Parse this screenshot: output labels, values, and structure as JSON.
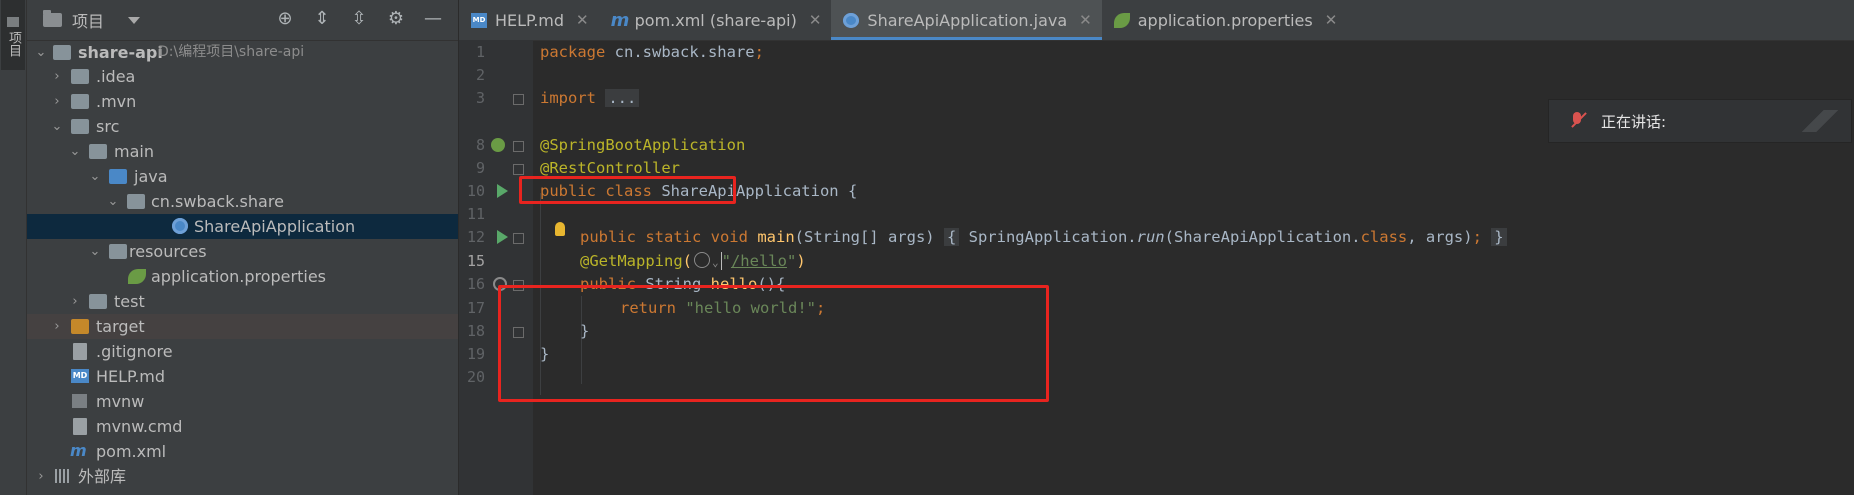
{
  "toolstrip": {
    "project_tab": "项目"
  },
  "project_panel": {
    "title": "项目",
    "tree": [
      {
        "label": "share-api",
        "path": "D:\\编程项目\\share-api",
        "icon": "folder-icon",
        "bold": true
      },
      {
        "label": ".idea",
        "icon": "folder-icon"
      },
      {
        "label": ".mvn",
        "icon": "folder-icon"
      },
      {
        "label": "src",
        "icon": "folder-icon"
      },
      {
        "label": "main",
        "icon": "folder-icon"
      },
      {
        "label": "java",
        "icon": "source-folder-icon"
      },
      {
        "label": "cn.swback.share",
        "icon": "package-icon"
      },
      {
        "label": "ShareApiApplication",
        "icon": "spring-boot-class-icon"
      },
      {
        "label": "resources",
        "icon": "resources-folder-icon"
      },
      {
        "label": "application.properties",
        "icon": "spring-properties-icon"
      },
      {
        "label": "test",
        "icon": "folder-icon"
      },
      {
        "label": "target",
        "icon": "excluded-folder-icon"
      },
      {
        "label": ".gitignore",
        "icon": "file-icon"
      },
      {
        "label": "HELP.md",
        "icon": "markdown-icon"
      },
      {
        "label": "mvnw",
        "icon": "terminal-file-icon"
      },
      {
        "label": "mvnw.cmd",
        "icon": "file-icon"
      },
      {
        "label": "pom.xml",
        "icon": "maven-icon"
      },
      {
        "label": "外部库",
        "icon": "library-icon"
      }
    ]
  },
  "tabs": [
    {
      "label": "HELP.md",
      "icon": "MD"
    },
    {
      "label": "pom.xml (share-api)",
      "icon": "m"
    },
    {
      "label": "ShareApiApplication.java",
      "active": true
    },
    {
      "label": "application.properties"
    }
  ],
  "code": {
    "line_numbers": [
      "1",
      "2",
      "3",
      "8",
      "9",
      "10",
      "11",
      "12",
      "15",
      "16",
      "17",
      "18",
      "19",
      "20"
    ],
    "l1_kw": "package",
    "l1_rest": " cn.swback.share",
    "l1_semi": ";",
    "l3_kw": "import",
    "l3_fold": "...",
    "l8_ann": "@SpringBootApplication",
    "l9_ann": "@RestController",
    "l10_kw": "public class",
    "l10_rest": " ShareApiApplication {",
    "l12_kw": "public static void",
    "l12_fn": "main",
    "l12_args": "(String[] args) ",
    "l12_fold_open": "{",
    "l12_call": " SpringApplication.",
    "l12_run": "run",
    "l12_call2": "(ShareApiApplication.",
    "l12_class_kw": "class",
    "l12_comma": ", args)",
    "l12_semi": ";",
    "l12_fold_close": "}",
    "l15_ann": "@GetMapping",
    "l15_paren": "(",
    "l15_str_q1": "\"",
    "l15_url": "/hello",
    "l15_str_q2": "\"",
    "l15_close": ")",
    "l16_kw": "public",
    "l16_type": " String ",
    "l16_fn": "hello",
    "l16_rest": "(){",
    "l17_kw": "return",
    "l17_str": "\"hello world!\"",
    "l17_semi": ";",
    "l18": "}",
    "l19": "}"
  },
  "call": {
    "text": "正在讲话:"
  }
}
